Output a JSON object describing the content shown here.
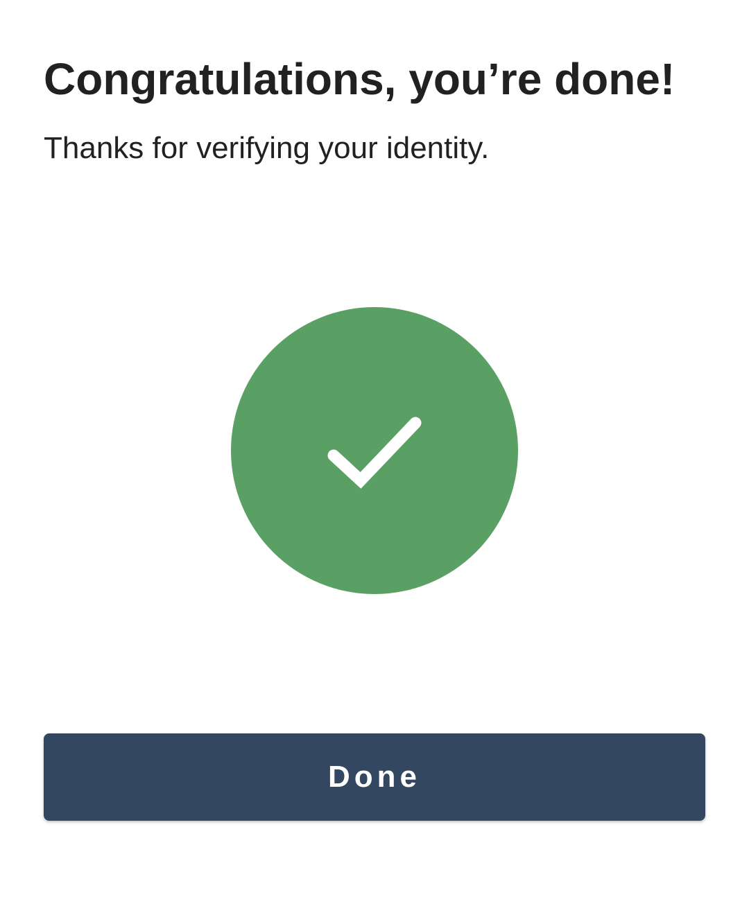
{
  "header": {
    "title": "Congratulations, you’re done!",
    "subtitle": "Thanks for verifying your identity."
  },
  "status": {
    "icon": "checkmark-icon",
    "color": "#5aa065"
  },
  "actions": {
    "done_label": "Done",
    "button_color": "#334761"
  }
}
